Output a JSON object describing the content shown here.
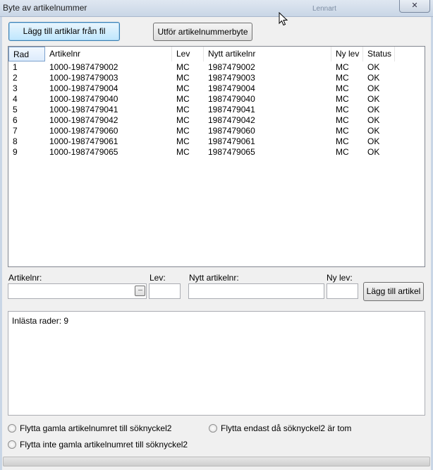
{
  "window": {
    "title": "Byte av artikelnummer",
    "background_hint": "Lennart",
    "close_glyph": "✕"
  },
  "toolbar": {
    "add_from_file_label": "Lägg till artiklar från fil",
    "run_replace_label": "Utför artikelnummerbyte"
  },
  "list": {
    "columns": [
      "Rad",
      "Artikelnr",
      "Lev",
      "Nytt artikelnr",
      "Ny lev",
      "Status"
    ],
    "rows": [
      [
        "1",
        "1000-1987479002",
        "MC",
        "1987479002",
        "MC",
        "OK"
      ],
      [
        "2",
        "1000-1987479003",
        "MC",
        "1987479003",
        "MC",
        "OK"
      ],
      [
        "3",
        "1000-1987479004",
        "MC",
        "1987479004",
        "MC",
        "OK"
      ],
      [
        "4",
        "1000-1987479040",
        "MC",
        "1987479040",
        "MC",
        "OK"
      ],
      [
        "5",
        "1000-1987479041",
        "MC",
        "1987479041",
        "MC",
        "OK"
      ],
      [
        "6",
        "1000-1987479042",
        "MC",
        "1987479042",
        "MC",
        "OK"
      ],
      [
        "7",
        "1000-1987479060",
        "MC",
        "1987479060",
        "MC",
        "OK"
      ],
      [
        "8",
        "1000-1987479061",
        "MC",
        "1987479061",
        "MC",
        "OK"
      ],
      [
        "9",
        "1000-1987479065",
        "MC",
        "1987479065",
        "MC",
        "OK"
      ]
    ]
  },
  "form": {
    "article_label": "Artikelnr:",
    "article_value": "",
    "browse_glyph": "···",
    "supplier_label": "Lev:",
    "supplier_value": "",
    "new_article_label": "Nytt artikelnr:",
    "new_article_value": "",
    "new_supplier_label": "Ny lev:",
    "new_supplier_value": "",
    "add_article_label": "Lägg till artikel"
  },
  "log": {
    "text": "Inlästa rader: 9"
  },
  "options": {
    "move_old": "Flytta gamla artikelnumret till söknyckel2",
    "move_only_empty": "Flytta endast då söknyckel2 är tom",
    "dont_move_old": "Flytta inte gamla artikelnumret till söknyckel2"
  }
}
